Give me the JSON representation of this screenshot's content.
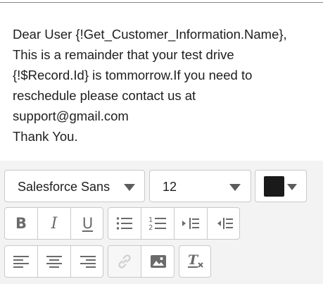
{
  "editor": {
    "lines": [
      "Dear User {!Get_Customer_Information.Name},",
      "This is a remainder that your test drive",
      "{!$Record.Id} is tommorrow.If you need to",
      "reschedule please contact us at",
      "support@gmail.com",
      "Thank You."
    ]
  },
  "toolbar": {
    "font_family": {
      "value": "Salesforce Sans",
      "icon": "chevron-down-icon"
    },
    "font_size": {
      "value": "12",
      "icon": "chevron-down-icon"
    },
    "text_color": {
      "value": "#1a1a1a",
      "icon": "chevron-down-icon"
    },
    "format_group": [
      {
        "icon": "bold-icon",
        "glyph": "B"
      },
      {
        "icon": "italic-icon",
        "glyph": "I"
      },
      {
        "icon": "underline-icon",
        "glyph": "U"
      }
    ],
    "list_group": [
      {
        "icon": "bullet-list-icon"
      },
      {
        "icon": "numbered-list-icon",
        "numerals": [
          "1",
          "2"
        ]
      },
      {
        "icon": "indent-icon"
      },
      {
        "icon": "outdent-icon"
      }
    ],
    "align_group": [
      {
        "icon": "align-left-icon"
      },
      {
        "icon": "align-center-icon"
      },
      {
        "icon": "align-right-icon"
      }
    ],
    "insert_group": [
      {
        "icon": "link-icon",
        "disabled": true
      },
      {
        "icon": "image-icon",
        "disabled": false
      }
    ],
    "clear_format": {
      "icon": "clear-formatting-icon",
      "glyph": "T"
    }
  }
}
